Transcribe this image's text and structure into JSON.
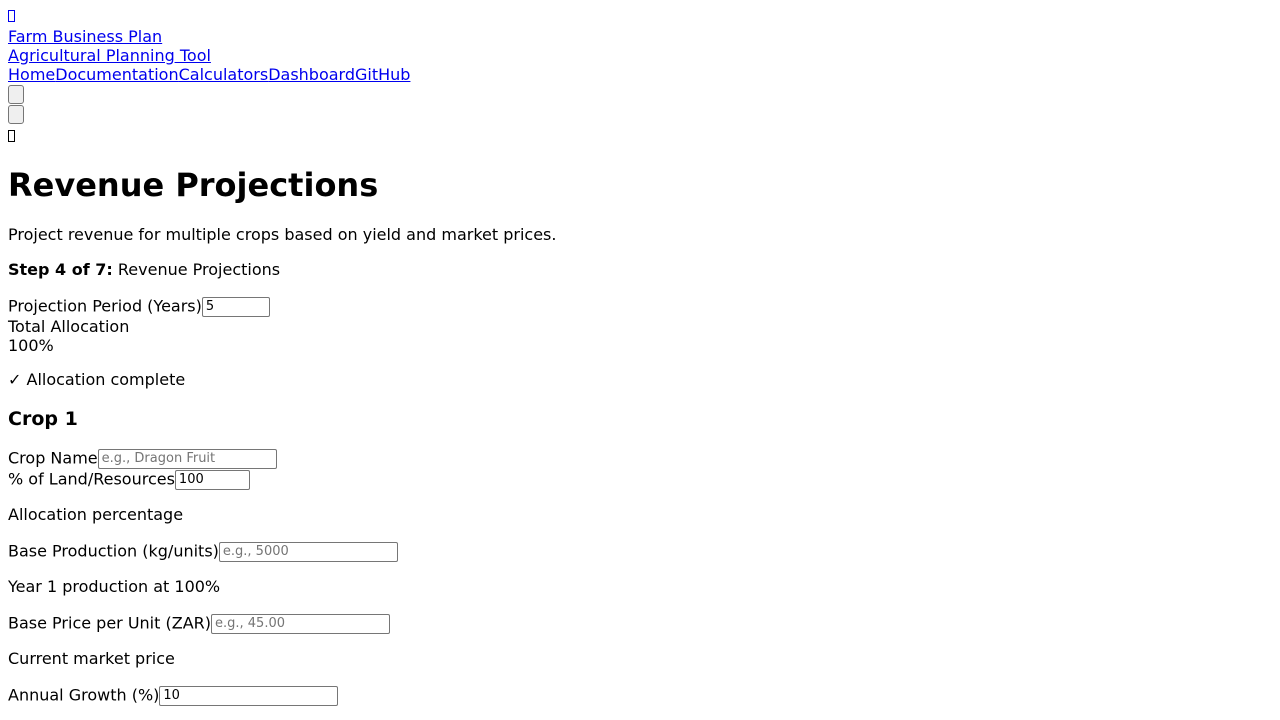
{
  "header": {
    "menu_icon": "menu-icon",
    "app_title": "Farm Business Plan",
    "app_subtitle": "Agricultural Planning Tool",
    "nav": [
      "Home",
      "Documentation",
      "Calculators",
      "Dashboard",
      "GitHub"
    ],
    "theme_icon": "theme-icon"
  },
  "main": {
    "title": "Revenue Projections",
    "description": "Project revenue for multiple crops based on yield and market prices.",
    "step_label": "Step 4 of 7:",
    "step_name": "Revenue Projections",
    "projection_period_label": "Projection Period (Years)",
    "projection_period_value": "5",
    "total_allocation_label": "Total Allocation",
    "total_allocation_value": "100%",
    "allocation_status": "✓ Allocation complete"
  },
  "crop": {
    "heading": "Crop 1",
    "name_label": "Crop Name",
    "name_placeholder": "e.g., Dragon Fruit",
    "land_label": "% of Land/Resources",
    "land_value": "100",
    "land_help": "Allocation percentage",
    "production_label": "Base Production (kg/units)",
    "production_placeholder": "e.g., 5000",
    "production_help": "Year 1 production at 100%",
    "price_label": "Base Price per Unit (ZAR)",
    "price_placeholder": "e.g., 45.00",
    "price_help": "Current market price",
    "growth_label": "Annual Growth (%)",
    "growth_value": "10"
  }
}
